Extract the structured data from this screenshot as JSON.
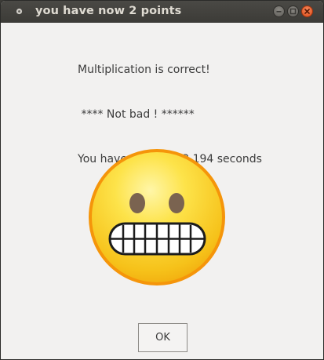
{
  "window": {
    "title": "you have now 2 points",
    "icons": {
      "app": "app-dot-icon",
      "minimize": "minimize-icon",
      "maximize": "maximize-icon",
      "close": "close-icon"
    }
  },
  "messages": [
    "Multiplication is correct!",
    " **** Not bad ! ******",
    "You have needed 23.194 seconds"
  ],
  "image": {
    "icon": "grimacing-face-icon"
  },
  "buttons": {
    "ok_label": "OK"
  },
  "colors": {
    "titlebar": "#3c3b37",
    "window_bg": "#f2f1f0",
    "close_button": "#df4b16",
    "smiley_face": "#f7c51e",
    "smiley_border": "#f5950a"
  }
}
